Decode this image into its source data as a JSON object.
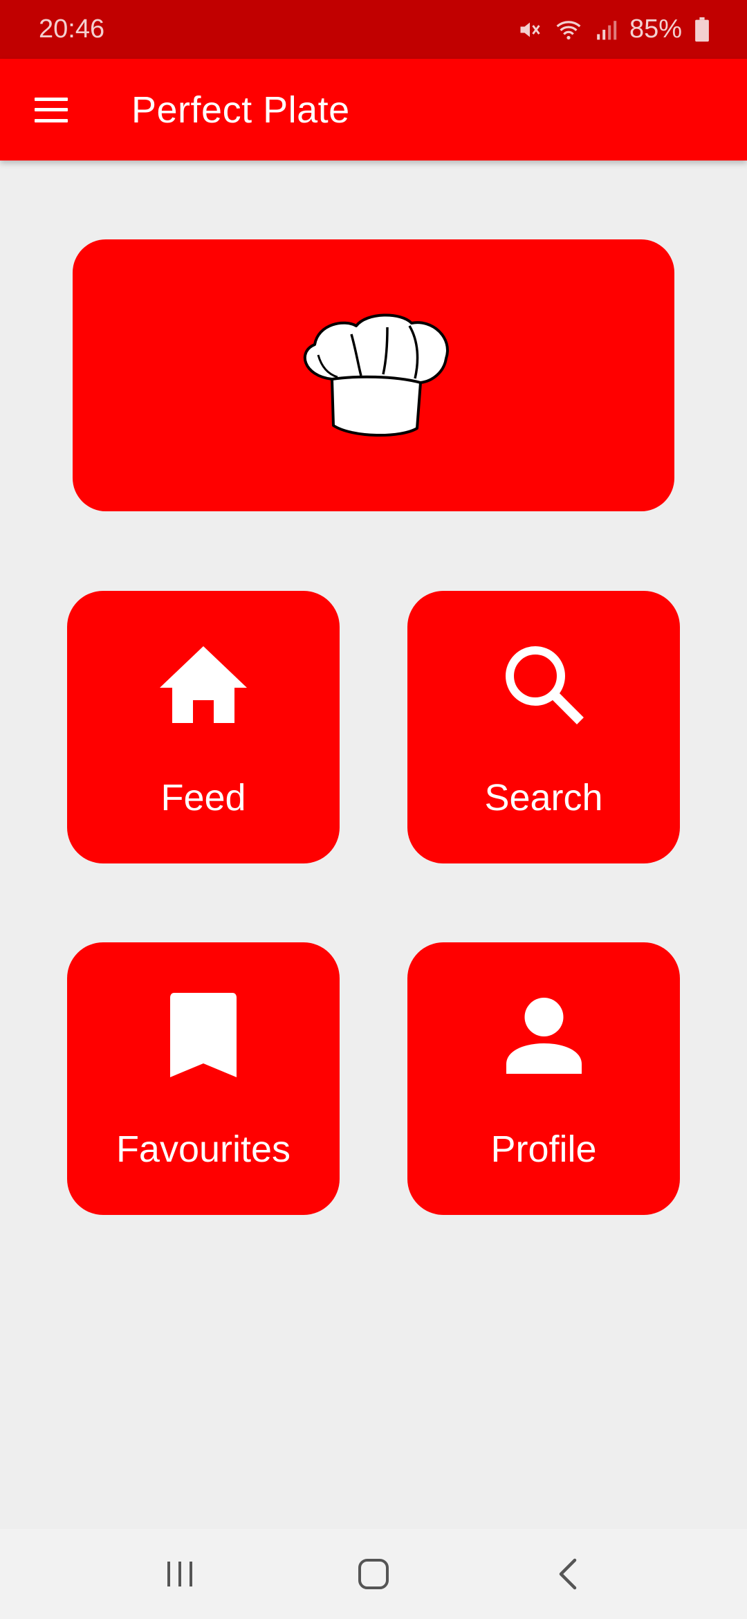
{
  "status_bar": {
    "time": "20:46",
    "battery_percent": "85%",
    "icons": [
      "mute-icon",
      "wifi-icon",
      "signal-icon",
      "battery-icon"
    ]
  },
  "app_bar": {
    "title": "Perfect Plate",
    "menu_icon": "hamburger-menu-icon"
  },
  "hero": {
    "icon": "chef-hat-icon"
  },
  "tiles": [
    {
      "label": "Feed",
      "icon": "home-icon"
    },
    {
      "label": "Search",
      "icon": "search-icon"
    },
    {
      "label": "Favourites",
      "icon": "bookmark-icon"
    },
    {
      "label": "Profile",
      "icon": "person-icon"
    }
  ],
  "nav_bar": {
    "icons": [
      "recent-apps-icon",
      "home-button-icon",
      "back-icon"
    ]
  },
  "colors": {
    "primary": "#ff0000",
    "status_bar": "#c10000",
    "background": "#eeeeee",
    "on_primary": "#ffffff"
  }
}
